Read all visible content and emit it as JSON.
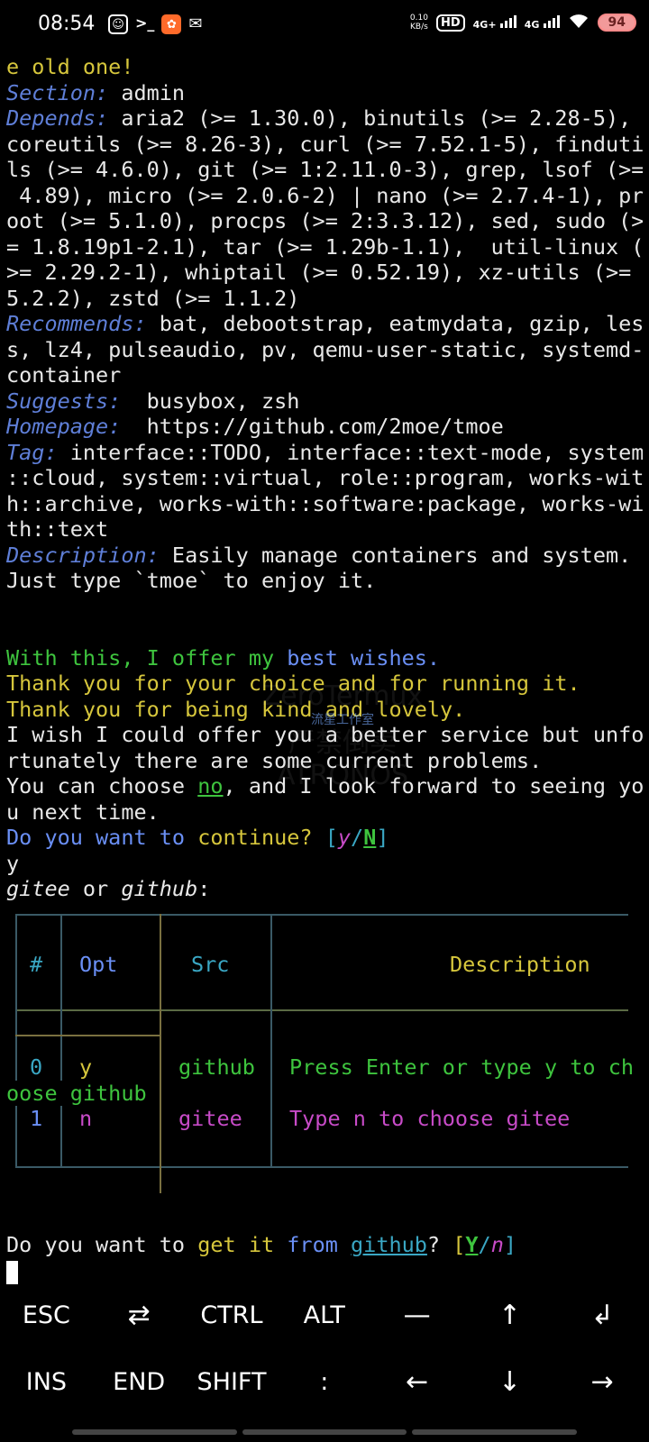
{
  "status": {
    "time": "08:54",
    "net_speed_value": "0.10",
    "net_speed_unit": "KB/s",
    "hd": "HD",
    "sim1": "4G+",
    "sim2": "4G",
    "battery": "94"
  },
  "terminal": {
    "lines": [
      [
        {
          "t": "e old one!",
          "c": "yel"
        }
      ],
      [
        {
          "t": "Section:",
          "c": "key"
        },
        {
          "t": " admin"
        }
      ],
      [
        {
          "t": "Depends:",
          "c": "key"
        },
        {
          "t": " aria2 (>= 1.30.0), binutils (>= 2.28-5),"
        }
      ],
      [
        {
          "t": "coreutils (>= 8.26-3), curl (>= 7.52.1-5), finduti"
        }
      ],
      [
        {
          "t": "ls (>= 4.6.0), git (>= 1:2.11.0-3), grep, lsof (>="
        }
      ],
      [
        {
          "t": " 4.89), micro (>= 2.0.6-2) | nano (>= 2.7.4-1), pr"
        }
      ],
      [
        {
          "t": "oot (>= 5.1.0), procps (>= 2:3.3.12), sed, sudo (>"
        }
      ],
      [
        {
          "t": "= 1.8.19p1-2.1), tar (>= 1.29b-1.1),  util-linux ("
        }
      ],
      [
        {
          "t": ">= 2.29.2-1), whiptail (>= 0.52.19), xz-utils (>="
        }
      ],
      [
        {
          "t": "5.2.2), zstd (>= 1.1.2)"
        }
      ],
      [
        {
          "t": "Recommends:",
          "c": "key"
        },
        {
          "t": " bat, debootstrap, eatmydata, gzip, les"
        }
      ],
      [
        {
          "t": "s, lz4, pulseaudio, pv, qemu-user-static, systemd-"
        }
      ],
      [
        {
          "t": "container"
        }
      ],
      [
        {
          "t": "Suggests:",
          "c": "key"
        },
        {
          "t": "  busybox, zsh"
        }
      ],
      [
        {
          "t": "Homepage:",
          "c": "key"
        },
        {
          "t": "  https://github.com/2moe/tmoe"
        }
      ],
      [
        {
          "t": "Tag:",
          "c": "key"
        },
        {
          "t": " interface::TODO, interface::text-mode, system"
        }
      ],
      [
        {
          "t": "::cloud, system::virtual, role::program, works-wit"
        }
      ],
      [
        {
          "t": "h::archive, works-with::software:package, works-wi"
        }
      ],
      [
        {
          "t": "th::text"
        }
      ],
      [
        {
          "t": "Description:",
          "c": "key"
        },
        {
          "t": " Easily manage containers and system."
        }
      ],
      [
        {
          "t": "Just type `tmoe` to enjoy it."
        }
      ],
      "blank",
      [
        {
          "t": "With this, I offer my ",
          "c": "g"
        },
        {
          "t": "best wishes.",
          "c": "b"
        }
      ],
      [
        {
          "t": "Thank you for your choice and for running it.",
          "c": "yel"
        }
      ],
      [
        {
          "t": "Thank you for being kind and lovely.",
          "c": "yel"
        }
      ],
      [
        {
          "t": "I wish I could offer you a better service but unfo"
        }
      ],
      [
        {
          "t": "rtunately there are some current problems."
        }
      ],
      [
        {
          "t": "You can choose "
        },
        {
          "t": "no",
          "c": "g u"
        },
        {
          "t": ", and I look forward to seeing yo"
        }
      ],
      [
        {
          "t": "u next time."
        }
      ],
      [
        {
          "t": "Do you want to ",
          "c": "b"
        },
        {
          "t": "continue? ",
          "c": "yel"
        },
        {
          "t": "[",
          "c": "cy"
        },
        {
          "t": "y",
          "c": "mag it"
        },
        {
          "t": "/",
          "c": "cy"
        },
        {
          "t": "N",
          "c": "g u bold"
        },
        {
          "t": "]",
          "c": "cy"
        }
      ],
      [
        {
          "t": "y"
        }
      ],
      [
        {
          "t": "gitee",
          "c": "it"
        },
        {
          "t": " or "
        },
        {
          "t": "github",
          "c": "it"
        },
        {
          "t": ":"
        }
      ]
    ],
    "prompt2": [
      {
        "t": "Do you want to "
      },
      {
        "t": "get it ",
        "c": "yel"
      },
      {
        "t": "from ",
        "c": "b"
      },
      {
        "t": "github",
        "c": "cy u"
      },
      {
        "t": "? "
      },
      {
        "t": "[",
        "c": "yel"
      },
      {
        "t": "Y",
        "c": "g u bold"
      },
      {
        "t": "/",
        "c": "cy"
      },
      {
        "t": "n",
        "c": "mag it"
      },
      {
        "t": "]",
        "c": "cy"
      }
    ]
  },
  "table": {
    "headers": {
      "num": "#",
      "opt": "Opt",
      "src": "Src",
      "desc": "Description"
    },
    "rows": [
      {
        "num": "0",
        "opt": "y",
        "src": "github",
        "desc": "Press Enter or type y to ch",
        "desc2": "oose github",
        "color": "g"
      },
      {
        "num": "1",
        "opt": "n",
        "src": "gitee",
        "desc": "Type n to choose gitee",
        "color": "mag"
      }
    ]
  },
  "watermark": {
    "l1": "ZeroTermux",
    "l2": "流星工作室",
    "l3": "严禁倒卖",
    "l4": "ATRONOS"
  },
  "extra_keys": {
    "row1": [
      "ESC",
      "⇄",
      "CTRL",
      "ALT",
      "—",
      "↑",
      "↲"
    ],
    "row2": [
      "INS",
      "END",
      "SHIFT",
      ":",
      "←",
      "↓",
      "→"
    ]
  },
  "extra_key_icons": {
    "row1": [
      "",
      "tab-icon",
      "",
      "",
      "dash-icon",
      "arrow-up-icon",
      "enter-icon"
    ],
    "row2": [
      "",
      "",
      "",
      "",
      "arrow-left-icon",
      "arrow-down-icon",
      "arrow-right-icon"
    ]
  }
}
